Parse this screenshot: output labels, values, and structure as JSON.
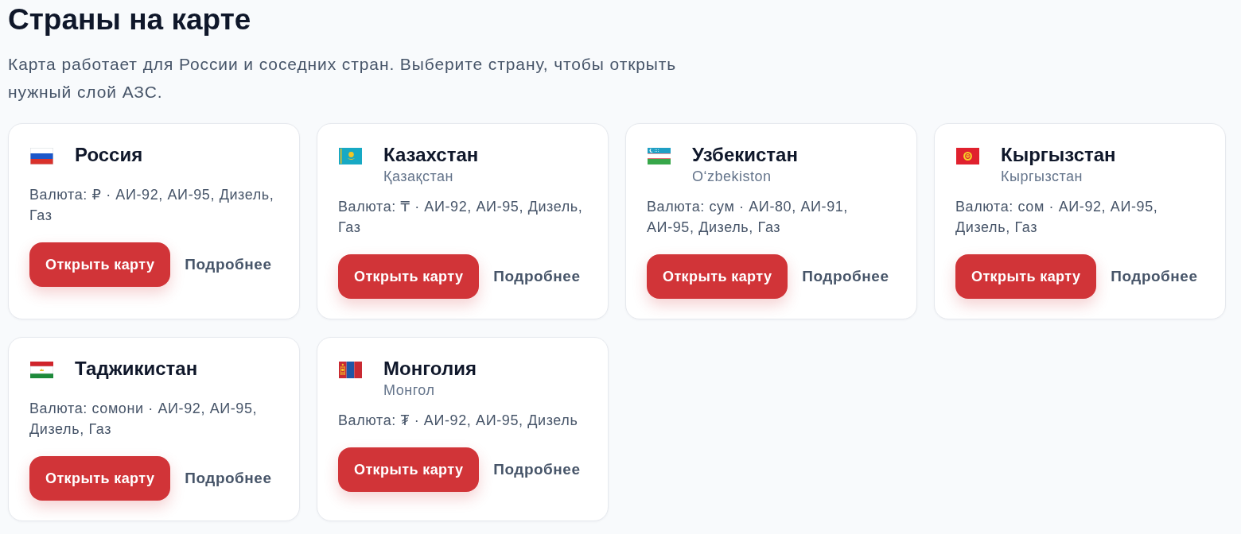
{
  "page": {
    "title": "Страны на карте",
    "description": "Карта работает для России и соседних стран. Выберите страну, чтобы открыть нужный слой АЗС."
  },
  "countries": [
    {
      "kind": "russia",
      "name": "Россия",
      "info": "Валюта: ₽ · АИ-92, АИ-95, Дизель, Газ",
      "open_button": "Открыть карту",
      "details_link": "Подробнее"
    },
    {
      "kind": "kazakhstan",
      "name": "Казахстан",
      "local_name": "Қазақстан",
      "info": "Валюта: ₸ · АИ-92, АИ-95, Дизель, Газ",
      "open_button": "Открыть карту",
      "details_link": "Подробнее"
    },
    {
      "kind": "uzbekistan",
      "name": "Узбекистан",
      "local_name": "Oʻzbekiston",
      "info": "Валюта: сум · АИ-80, АИ-91, АИ-95, Дизель, Газ",
      "open_button": "Открыть карту",
      "details_link": "Подробнее"
    },
    {
      "kind": "kyrgyzstan",
      "name": "Кыргызстан",
      "local_name": "Кыргызстан",
      "info": "Валюта: сом · АИ-92, АИ-95, Дизель, Газ",
      "open_button": "Открыть карту",
      "details_link": "Подробнее"
    },
    {
      "kind": "tajikistan",
      "name": "Таджикистан",
      "info": "Валюта: сомони · АИ-92, АИ-95, Дизель, Газ",
      "open_button": "Открыть карту",
      "details_link": "Подробнее"
    },
    {
      "kind": "mongolia",
      "name": "Монголия",
      "local_name": "Монгол",
      "info": "Валюта: ₮ · АИ-92, АИ-95, Дизель",
      "open_button": "Открыть карту",
      "details_link": "Подробнее"
    }
  ]
}
